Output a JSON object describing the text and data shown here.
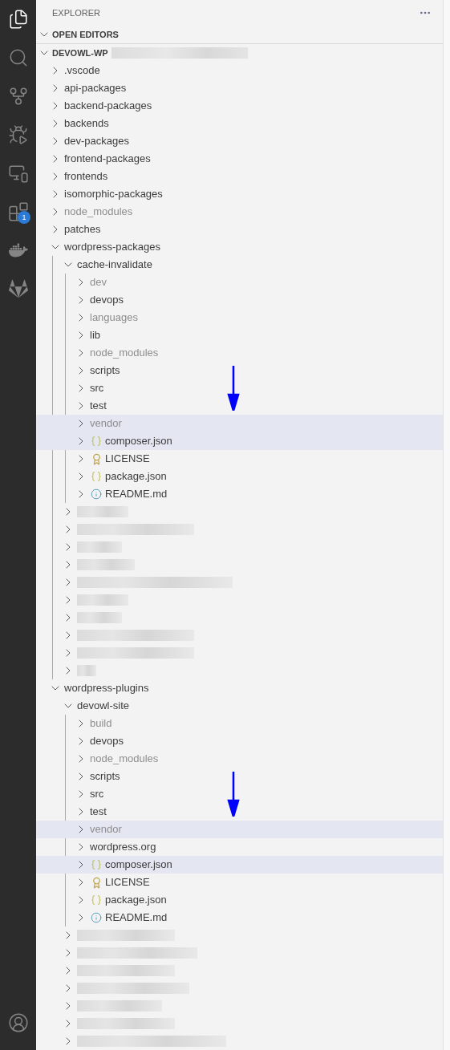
{
  "activity_bar": {
    "items": [
      {
        "kind": "files",
        "selected": true
      },
      {
        "kind": "search",
        "selected": false
      },
      {
        "kind": "source-control",
        "selected": false
      },
      {
        "kind": "run-debug",
        "selected": false
      },
      {
        "kind": "remote",
        "selected": false
      },
      {
        "kind": "extensions",
        "selected": false,
        "badge": "1"
      },
      {
        "kind": "docker",
        "selected": false
      },
      {
        "kind": "gitlab",
        "selected": false
      }
    ],
    "bottom": [
      {
        "kind": "account",
        "selected": false
      }
    ]
  },
  "sidebar": {
    "title": "EXPLORER",
    "sections": [
      {
        "label": "OPEN EDITORS",
        "expanded": true
      },
      {
        "label": "DEVOWL-WP",
        "expanded": true,
        "redacted_suffix": true,
        "tree": [
          {
            "kind": "folder",
            "label": ".vscode",
            "expanded": false,
            "dimmed": false,
            "selected": false
          },
          {
            "kind": "folder",
            "label": "api-packages",
            "expanded": false,
            "dimmed": false,
            "selected": false
          },
          {
            "kind": "folder",
            "label": "backend-packages",
            "expanded": false,
            "dimmed": false,
            "selected": false
          },
          {
            "kind": "folder",
            "label": "backends",
            "expanded": false,
            "dimmed": false,
            "selected": false
          },
          {
            "kind": "folder",
            "label": "dev-packages",
            "expanded": false,
            "dimmed": false,
            "selected": false
          },
          {
            "kind": "folder",
            "label": "frontend-packages",
            "expanded": false,
            "dimmed": false,
            "selected": false
          },
          {
            "kind": "folder",
            "label": "frontends",
            "expanded": false,
            "dimmed": false,
            "selected": false
          },
          {
            "kind": "folder",
            "label": "isomorphic-packages",
            "expanded": false,
            "dimmed": false,
            "selected": false
          },
          {
            "kind": "folder",
            "label": "node_modules",
            "expanded": false,
            "dimmed": true,
            "selected": false
          },
          {
            "kind": "folder",
            "label": "patches",
            "expanded": false,
            "dimmed": false,
            "selected": false
          },
          {
            "kind": "folder",
            "label": "wordpress-packages",
            "expanded": true,
            "dimmed": false,
            "selected": false,
            "guide": true,
            "children": [
              {
                "kind": "folder",
                "label": "cache-invalidate",
                "expanded": true,
                "dimmed": false,
                "selected": false,
                "guide": true,
                "children": [
                  {
                    "kind": "folder",
                    "label": "dev",
                    "expanded": false,
                    "dimmed": true,
                    "selected": false
                  },
                  {
                    "kind": "folder",
                    "label": "devops",
                    "expanded": false,
                    "dimmed": false,
                    "selected": false
                  },
                  {
                    "kind": "folder",
                    "label": "languages",
                    "expanded": false,
                    "dimmed": true,
                    "selected": false
                  },
                  {
                    "kind": "folder",
                    "label": "lib",
                    "expanded": false,
                    "dimmed": false,
                    "selected": false
                  },
                  {
                    "kind": "folder",
                    "label": "node_modules",
                    "expanded": false,
                    "dimmed": true,
                    "selected": false
                  },
                  {
                    "kind": "folder",
                    "label": "scripts",
                    "expanded": false,
                    "dimmed": false,
                    "selected": false
                  },
                  {
                    "kind": "folder",
                    "label": "src",
                    "expanded": false,
                    "dimmed": false,
                    "selected": false,
                    "arrow": true
                  },
                  {
                    "kind": "folder",
                    "label": "test",
                    "expanded": false,
                    "dimmed": false,
                    "selected": false
                  },
                  {
                    "kind": "folder",
                    "label": "vendor",
                    "expanded": false,
                    "dimmed": true,
                    "selected": true
                  },
                  {
                    "kind": "json-file",
                    "label": "composer.json",
                    "dimmed": false,
                    "selected": true
                  },
                  {
                    "kind": "license-file",
                    "label": "LICENSE",
                    "dimmed": false,
                    "selected": false
                  },
                  {
                    "kind": "json-file",
                    "label": "package.json",
                    "dimmed": false,
                    "selected": false
                  },
                  {
                    "kind": "info-file",
                    "label": "README.md",
                    "dimmed": false,
                    "selected": false
                  }
                ]
              },
              {
                "kind": "redacted"
              },
              {
                "kind": "redacted"
              },
              {
                "kind": "redacted"
              },
              {
                "kind": "redacted"
              },
              {
                "kind": "redacted"
              },
              {
                "kind": "redacted"
              },
              {
                "kind": "redacted"
              },
              {
                "kind": "redacted"
              },
              {
                "kind": "redacted"
              },
              {
                "kind": "redacted"
              }
            ]
          },
          {
            "kind": "folder",
            "label": "wordpress-plugins",
            "expanded": true,
            "dimmed": false,
            "selected": false,
            "children": [
              {
                "kind": "folder",
                "label": "devowl-site",
                "expanded": true,
                "dimmed": false,
                "selected": false,
                "guide": true,
                "children": [
                  {
                    "kind": "folder",
                    "label": "build",
                    "expanded": false,
                    "dimmed": true,
                    "selected": false
                  },
                  {
                    "kind": "folder",
                    "label": "devops",
                    "expanded": false,
                    "dimmed": false,
                    "selected": false
                  },
                  {
                    "kind": "folder",
                    "label": "node_modules",
                    "expanded": false,
                    "dimmed": true,
                    "selected": false
                  },
                  {
                    "kind": "folder",
                    "label": "scripts",
                    "expanded": false,
                    "dimmed": false,
                    "selected": false
                  },
                  {
                    "kind": "folder",
                    "label": "src",
                    "expanded": false,
                    "dimmed": false,
                    "selected": false,
                    "arrow": true
                  },
                  {
                    "kind": "folder",
                    "label": "test",
                    "expanded": false,
                    "dimmed": false,
                    "selected": false
                  },
                  {
                    "kind": "folder",
                    "label": "vendor",
                    "expanded": false,
                    "dimmed": true,
                    "selected": true
                  },
                  {
                    "kind": "folder",
                    "label": "wordpress.org",
                    "expanded": false,
                    "dimmed": false,
                    "selected": false
                  },
                  {
                    "kind": "json-file",
                    "label": "composer.json",
                    "dimmed": false,
                    "selected": true
                  },
                  {
                    "kind": "license-file",
                    "label": "LICENSE",
                    "dimmed": false,
                    "selected": false
                  },
                  {
                    "kind": "json-file",
                    "label": "package.json",
                    "dimmed": false,
                    "selected": false
                  },
                  {
                    "kind": "info-file",
                    "label": "README.md",
                    "dimmed": false,
                    "selected": false
                  }
                ]
              },
              {
                "kind": "redacted"
              },
              {
                "kind": "redacted"
              },
              {
                "kind": "redacted"
              },
              {
                "kind": "redacted"
              },
              {
                "kind": "redacted"
              },
              {
                "kind": "redacted"
              },
              {
                "kind": "redacted"
              }
            ]
          }
        ]
      }
    ]
  }
}
